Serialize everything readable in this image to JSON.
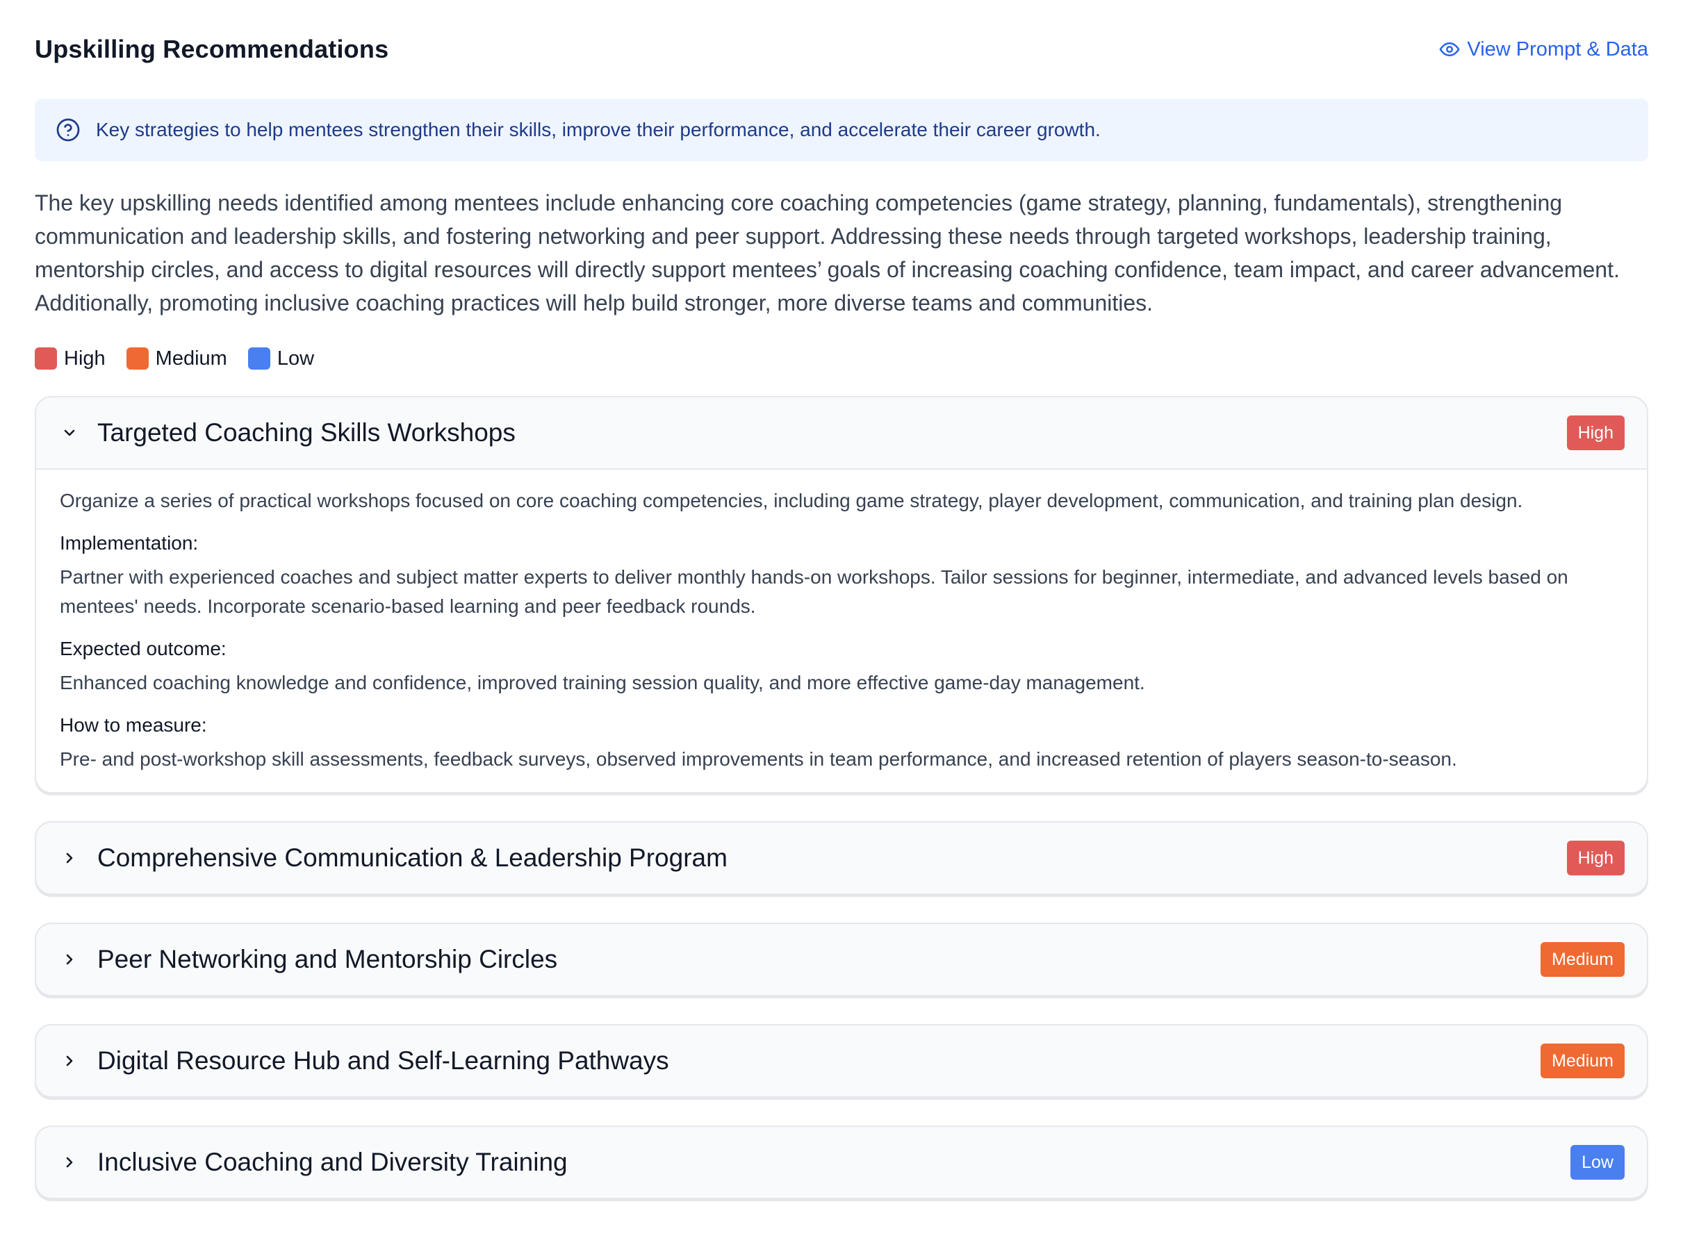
{
  "header": {
    "title": "Upskilling Recommendations",
    "view_link": "View Prompt & Data"
  },
  "info": {
    "text": "Key strategies to help mentees strengthen their skills, improve their performance, and accelerate their career growth."
  },
  "summary": "The key upskilling needs identified among mentees include enhancing core coaching competencies (game strategy, planning, fundamentals), strengthening communication and leadership skills, and fostering networking and peer support. Addressing these needs through targeted workshops, leadership training, mentorship circles, and access to digital resources will directly support mentees’ goals of increasing coaching confidence, team impact, and career advancement. Additionally, promoting inclusive coaching practices will help build stronger, more diverse teams and communities.",
  "legend": [
    {
      "label": "High",
      "color": "#e05a57"
    },
    {
      "label": "Medium",
      "color": "#ee6a32"
    },
    {
      "label": "Low",
      "color": "#4a7ff0"
    }
  ],
  "recommendations": [
    {
      "title": "Targeted Coaching Skills Workshops",
      "priority": "High",
      "color": "#e05a57",
      "expanded": true,
      "description": "Organize a series of practical workshops focused on core coaching competencies, including game strategy, player development, communication, and training plan design.",
      "implementation_label": "Implementation:",
      "implementation": "Partner with experienced coaches and subject matter experts to deliver monthly hands-on workshops. Tailor sessions for beginner, intermediate, and advanced levels based on mentees' needs. Incorporate scenario-based learning and peer feedback rounds.",
      "outcome_label": "Expected outcome:",
      "outcome": "Enhanced coaching knowledge and confidence, improved training session quality, and more effective game-day management.",
      "measure_label": "How to measure:",
      "measure": "Pre- and post-workshop skill assessments, feedback surveys, observed improvements in team performance, and increased retention of players season-to-season."
    },
    {
      "title": "Comprehensive Communication & Leadership Program",
      "priority": "High",
      "color": "#e05a57",
      "expanded": false
    },
    {
      "title": "Peer Networking and Mentorship Circles",
      "priority": "Medium",
      "color": "#ee6a32",
      "expanded": false
    },
    {
      "title": "Digital Resource Hub and Self-Learning Pathways",
      "priority": "Medium",
      "color": "#ee6a32",
      "expanded": false
    },
    {
      "title": "Inclusive Coaching and Diversity Training",
      "priority": "Low",
      "color": "#4a7ff0",
      "expanded": false
    }
  ]
}
